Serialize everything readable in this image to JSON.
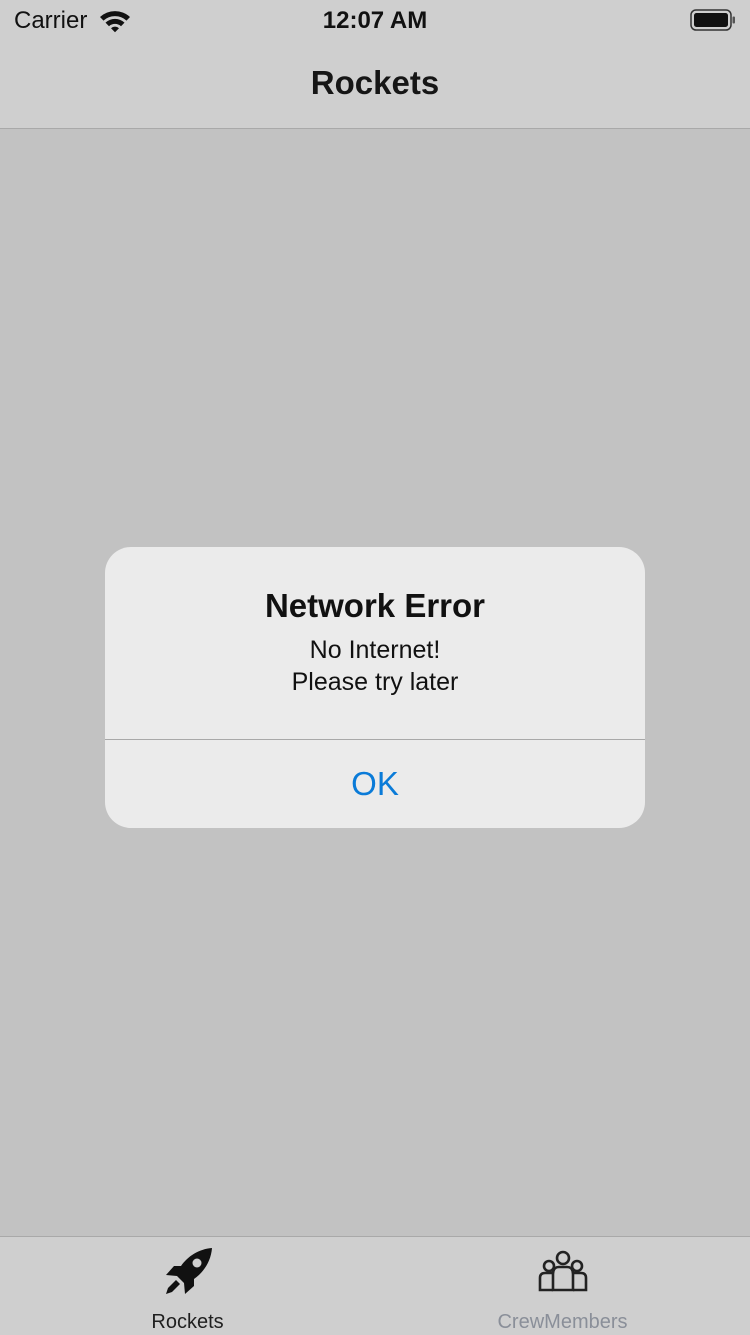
{
  "status_bar": {
    "carrier": "Carrier",
    "time": "12:07 AM"
  },
  "nav": {
    "title": "Rockets"
  },
  "alert": {
    "title": "Network Error",
    "message_line1": "No Internet!",
    "message_line2": "Please try later",
    "ok_label": "OK"
  },
  "tabs": [
    {
      "label": "Rockets",
      "icon": "rocket-icon",
      "selected": true
    },
    {
      "label": "CrewMembers",
      "icon": "crew-members-icon",
      "selected": false
    }
  ],
  "colors": {
    "accent": "#0a7bd8",
    "dimmed_background": "#c2c2c2",
    "alert_background": "#ebebeb",
    "tab_unselected": "#8a8f99"
  }
}
